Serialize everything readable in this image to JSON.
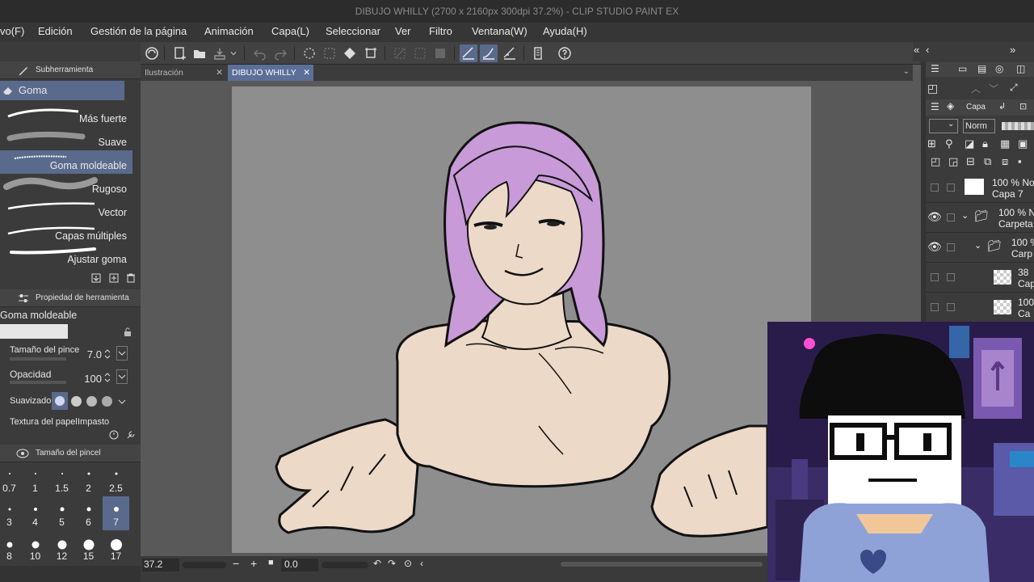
{
  "window": {
    "title": "DIBUJO WHILLY (2700 x 2160px 300dpi 37.2%)  - CLIP STUDIO PAINT EX"
  },
  "menu": [
    "vo(F)",
    "Edición",
    "Gestión de la página",
    "Animación",
    "Capa(L)",
    "Seleccionar",
    "Ver",
    "Filtro",
    "Ventana(W)",
    "Ayuda(H)"
  ],
  "subtool": {
    "header": "Subherramienta",
    "group": "Goma",
    "brushes": [
      {
        "label": "Más fuerte"
      },
      {
        "label": "Suave"
      },
      {
        "label": "Goma moldeable",
        "selected": true
      },
      {
        "label": "Rugoso"
      },
      {
        "label": "Vector"
      },
      {
        "label": "Capas múltiples"
      },
      {
        "label": "Ajustar goma"
      }
    ]
  },
  "tool_property": {
    "header": "Propiedad de herramienta",
    "tool_name": "Goma moldeable",
    "brush_size_label": "Tamaño del pince",
    "brush_size_value": "7.0",
    "opacity_label": "Opacidad",
    "opacity_value": "100",
    "smoothing_label": "Suavizado",
    "texture_label": "Textura del papel",
    "texture_value": "Impasto"
  },
  "brush_size_panel": {
    "header": "Tamaño del pincel",
    "sizes": [
      "0.7",
      "1",
      "1.5",
      "2",
      "2.5",
      "3",
      "4",
      "5",
      "6",
      "7",
      "8",
      "10",
      "12",
      "15",
      "17"
    ],
    "selected": "7"
  },
  "canvas_tabs": [
    {
      "label": "Ilustración",
      "active": false
    },
    {
      "label": "DIBUJO WHILLY",
      "active": true
    }
  ],
  "status": {
    "zoom": "37.2",
    "rotation": "0.0"
  },
  "layers": {
    "header": "Capa",
    "blend_mode": "Norm",
    "rows": [
      {
        "opacity": "100 % No",
        "name": "Capa 7"
      },
      {
        "opacity": "100 % N",
        "name": "Carpeta"
      },
      {
        "opacity": "100 %",
        "name": "Carp"
      },
      {
        "opacity": "38",
        "name": "Cap"
      },
      {
        "opacity": "100",
        "name": "Ca"
      }
    ]
  },
  "colors": {
    "accent": "#5a6a8c",
    "hair": "#c89ad8",
    "skin": "#ecd9c8",
    "paper_bg": "#8e8e8e",
    "webcam_bg": "#2a1c4a",
    "hoodie": "#8fa2d8"
  }
}
